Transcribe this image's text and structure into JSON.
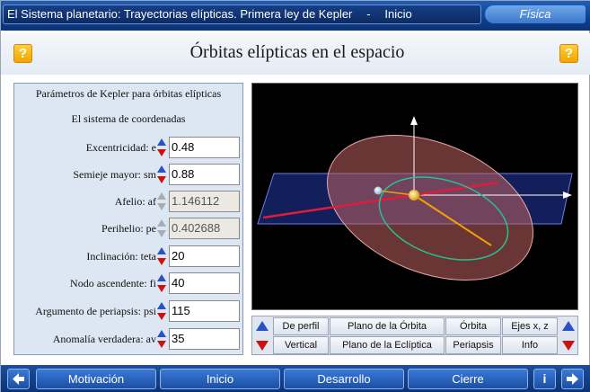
{
  "window": {
    "title": "El Sistema planetario: Trayectorias elípticas. Primera ley de Kepler",
    "separator": "-",
    "section": "Inicio",
    "subject": "Física"
  },
  "header": {
    "title": "Órbitas elípticas en el espacio",
    "help_label": "?"
  },
  "panel": {
    "heading": "Parámetros de Kepler para órbitas elípticas",
    "subheading": "El sistema de coordenadas",
    "params": [
      {
        "label": "Excentricidad: e",
        "value": "0.48",
        "editable": true
      },
      {
        "label": "Semieje mayor: sm",
        "value": "0.88",
        "editable": true
      },
      {
        "label": "Afelio: af",
        "value": "1.146112",
        "editable": false
      },
      {
        "label": "Perihelio: pe",
        "value": "0.402688",
        "editable": false
      },
      {
        "label": "Inclinación: teta",
        "value": "20",
        "editable": true
      },
      {
        "label": "Nodo ascendente: fi",
        "value": "40",
        "editable": true
      },
      {
        "label": "Argumento de periapsis: psi",
        "value": "115",
        "editable": true
      },
      {
        "label": "Anomalía verdadera: av",
        "value": "35",
        "editable": true
      }
    ]
  },
  "controls": {
    "row1": [
      "De perfil",
      "Plano de la Órbita",
      "Órbita",
      "Ejes x, z"
    ],
    "row2": [
      "Vertical",
      "Plano de la Eclíptica",
      "Periapsis",
      "Info"
    ]
  },
  "footer": {
    "back_icon": "arrow-left-icon",
    "nav": [
      "Motivación",
      "Inicio",
      "Desarrollo",
      "Cierre"
    ],
    "info_label": "i",
    "forward_icon": "arrow-right-icon"
  },
  "colors": {
    "titlebar": "#0e3f8f",
    "orbit_plane": "#c85a5a",
    "ecliptic_plane": "#2a3a8c",
    "node_line": "#e01b3c",
    "apsis_line": "#f0a000",
    "orbit": "#2bbf8c"
  }
}
